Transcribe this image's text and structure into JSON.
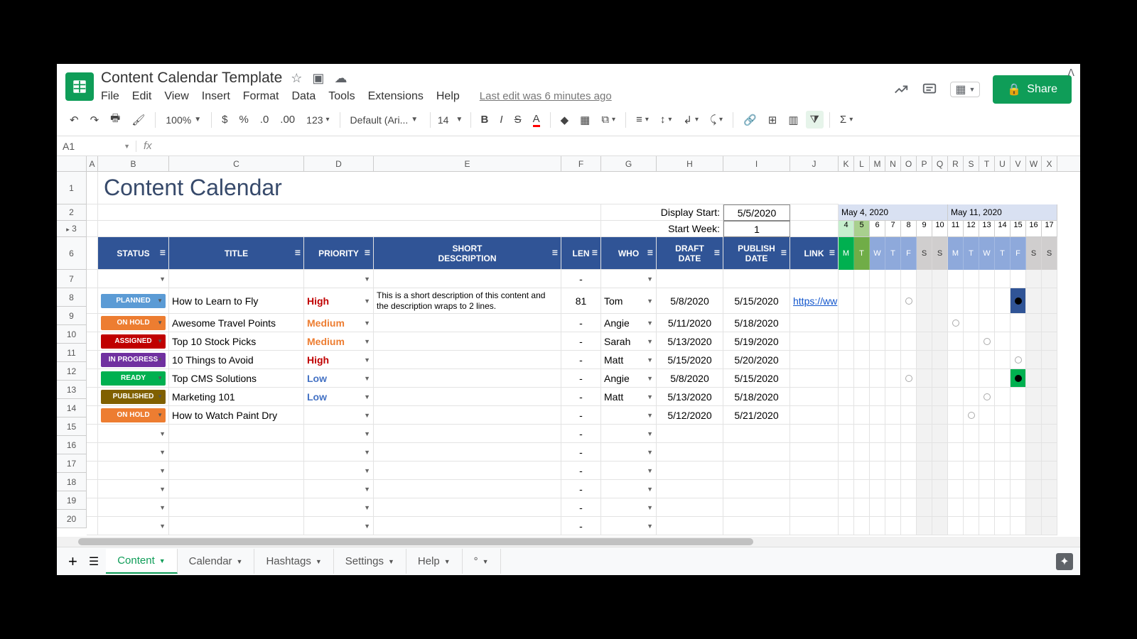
{
  "doc": {
    "title": "Content Calendar Template",
    "last_edit": "Last edit was 6 minutes ago"
  },
  "menus": [
    "File",
    "Edit",
    "View",
    "Insert",
    "Format",
    "Data",
    "Tools",
    "Extensions",
    "Help"
  ],
  "share_label": "Share",
  "toolbar": {
    "zoom": "100%",
    "font": "Default (Ari...",
    "size": "14"
  },
  "namebox": "A1",
  "columns_letters": [
    "A",
    "B",
    "C",
    "D",
    "E",
    "F",
    "G",
    "H",
    "I",
    "J",
    "K",
    "L",
    "M",
    "N",
    "O",
    "P",
    "Q",
    "R",
    "S",
    "T",
    "U",
    "V",
    "W",
    "X"
  ],
  "row_numbers": [
    1,
    2,
    3,
    6,
    7,
    8,
    9,
    10,
    11,
    12,
    13,
    14,
    15,
    16,
    17,
    18,
    19,
    20
  ],
  "sheet_title": "Content Calendar",
  "display_start": {
    "label": "Display Start:",
    "value": "5/5/2020"
  },
  "start_week": {
    "label": "Start Week:",
    "value": "1"
  },
  "cal_months": [
    "May 4, 2020",
    "May 11, 2020"
  ],
  "cal_daynums": [
    "4",
    "5",
    "6",
    "7",
    "8",
    "9",
    "10",
    "11",
    "12",
    "13",
    "14",
    "15",
    "16",
    "17"
  ],
  "cal_daylbls": [
    "M",
    "T",
    "W",
    "T",
    "F",
    "S",
    "S",
    "M",
    "T",
    "W",
    "T",
    "F",
    "S",
    "S"
  ],
  "headers": {
    "status": "STATUS",
    "title": "TITLE",
    "priority": "PRIORITY",
    "desc": "SHORT DESCRIPTION",
    "len": "LEN",
    "who": "WHO",
    "draft": "DRAFT DATE",
    "publish": "PUBLISH DATE",
    "link": "LINK"
  },
  "rows": [
    {
      "r": 7,
      "empty": true
    },
    {
      "r": 8,
      "status": "PLANNED",
      "status_cls": "s-planned",
      "title": "How to Learn to Fly",
      "priority": "High",
      "desc": "This is a short description of this content and the description wraps to 2 lines.",
      "len": "81",
      "who": "Tom",
      "draft": "5/8/2020",
      "publish": "5/15/2020",
      "link": "https://ww",
      "marks": [
        {
          "i": 4,
          "type": "open"
        },
        {
          "i": 11,
          "type": "fill",
          "bg": "#305496",
          "dot": "#000"
        }
      ]
    },
    {
      "r": 9,
      "status": "ON HOLD",
      "status_cls": "s-onhold",
      "title": "Awesome Travel Points",
      "priority": "Medium",
      "len": "-",
      "who": "Angie",
      "draft": "5/11/2020",
      "publish": "5/18/2020",
      "marks": [
        {
          "i": 7,
          "type": "open"
        }
      ]
    },
    {
      "r": 10,
      "status": "ASSIGNED",
      "status_cls": "s-assigned",
      "title": "Top 10 Stock Picks",
      "priority": "Medium",
      "len": "-",
      "who": "Sarah",
      "draft": "5/13/2020",
      "publish": "5/19/2020",
      "marks": [
        {
          "i": 9,
          "type": "open"
        }
      ]
    },
    {
      "r": 11,
      "status": "IN PROGRESS",
      "status_cls": "s-inprogress",
      "title": "10 Things to Avoid",
      "priority": "High",
      "len": "-",
      "who": "Matt",
      "draft": "5/15/2020",
      "publish": "5/20/2020",
      "marks": [
        {
          "i": 11,
          "type": "open"
        }
      ]
    },
    {
      "r": 12,
      "status": "READY",
      "status_cls": "s-ready",
      "title": "Top CMS Solutions",
      "priority": "Low",
      "len": "-",
      "who": "Angie",
      "draft": "5/8/2020",
      "publish": "5/15/2020",
      "marks": [
        {
          "i": 4,
          "type": "open"
        },
        {
          "i": 11,
          "type": "fill",
          "bg": "#00b050",
          "dot": "#000"
        }
      ]
    },
    {
      "r": 13,
      "status": "PUBLISHED",
      "status_cls": "s-published",
      "title": "Marketing 101",
      "priority": "Low",
      "len": "-",
      "who": "Matt",
      "draft": "5/13/2020",
      "publish": "5/18/2020",
      "marks": [
        {
          "i": 9,
          "type": "open"
        }
      ]
    },
    {
      "r": 14,
      "status": "ON HOLD",
      "status_cls": "s-onhold",
      "title": "How to Watch Paint Dry",
      "len": "-",
      "draft": "5/12/2020",
      "publish": "5/21/2020",
      "marks": [
        {
          "i": 8,
          "type": "open"
        }
      ]
    },
    {
      "r": 15,
      "empty": true,
      "len": "-"
    },
    {
      "r": 16,
      "empty": true,
      "len": "-"
    },
    {
      "r": 17,
      "empty": true,
      "len": "-"
    },
    {
      "r": 18,
      "empty": true,
      "len": "-"
    },
    {
      "r": 19,
      "empty": true,
      "len": "-"
    },
    {
      "r": 20,
      "empty": true,
      "len": "-"
    }
  ],
  "tabs": [
    "Content",
    "Calendar",
    "Hashtags",
    "Settings",
    "Help",
    "°"
  ]
}
